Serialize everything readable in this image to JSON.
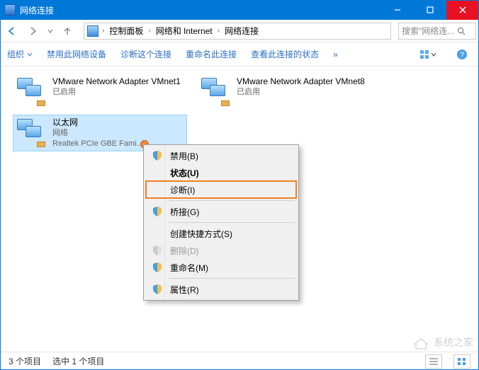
{
  "window": {
    "title": "网络连接"
  },
  "nav": {
    "crumbs": [
      "控制面板",
      "网络和 Internet",
      "网络连接"
    ],
    "search_placeholder": "搜索\"网络连..."
  },
  "toolbar": {
    "organize": "组织",
    "disable": "禁用此网络设备",
    "diagnose": "诊断这个连接",
    "rename": "重命名此连接",
    "viewstatus": "查看此连接的状态"
  },
  "items": [
    {
      "name": "VMware Network Adapter VMnet1",
      "line2": "已启用",
      "line3": ""
    },
    {
      "name": "VMware Network Adapter VMnet8",
      "line2": "已启用",
      "line3": ""
    },
    {
      "name": "以太网",
      "line2": "网络",
      "line3": "Realtek PCIe GBE Fami..."
    }
  ],
  "ctxmenu": {
    "disable": "禁用(B)",
    "status": "状态(U)",
    "diagnose": "诊断(I)",
    "bridge": "桥接(G)",
    "shortcut": "创建快捷方式(S)",
    "delete": "删除(D)",
    "rename": "重命名(M)",
    "properties": "属性(R)"
  },
  "status": {
    "count": "3 个项目",
    "selected": "选中 1 个项目"
  },
  "watermark": "系统之家"
}
